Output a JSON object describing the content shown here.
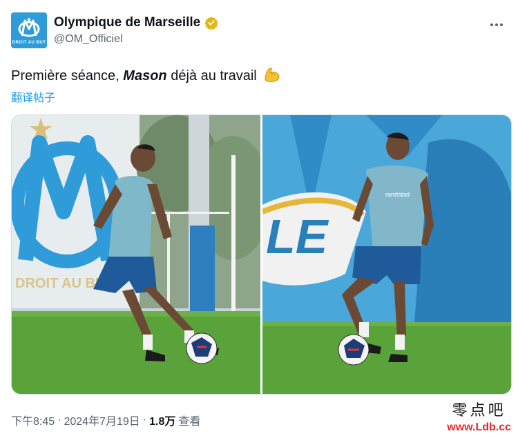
{
  "account": {
    "display_name": "Olympique de Marseille",
    "handle": "@OM_Officiel",
    "avatar_caption": "DROIT AU BUT",
    "avatar_color": "#2f9bd9",
    "verified_color": "#e2b719"
  },
  "post": {
    "text_before": "Première séance, ",
    "text_bold": "Mason",
    "text_after": " déjà au travail",
    "emoji": "flexed-biceps",
    "translate_label": "翻译帖子"
  },
  "media": {
    "left_photo_text": "DROIT AU BUT",
    "right_photo_text": "LE",
    "shirt_sponsor": "randstad"
  },
  "footer": {
    "time": "下午8:45",
    "separator": "·",
    "date": "2024年7月19日",
    "views_count": "1.8万",
    "views_label": "查看"
  },
  "watermark": {
    "text": "零点吧",
    "url": "www.Ldb.cc"
  },
  "colors": {
    "link": "#1d9bf0",
    "secondary_text": "#536471",
    "grass": "#5aa23a"
  }
}
